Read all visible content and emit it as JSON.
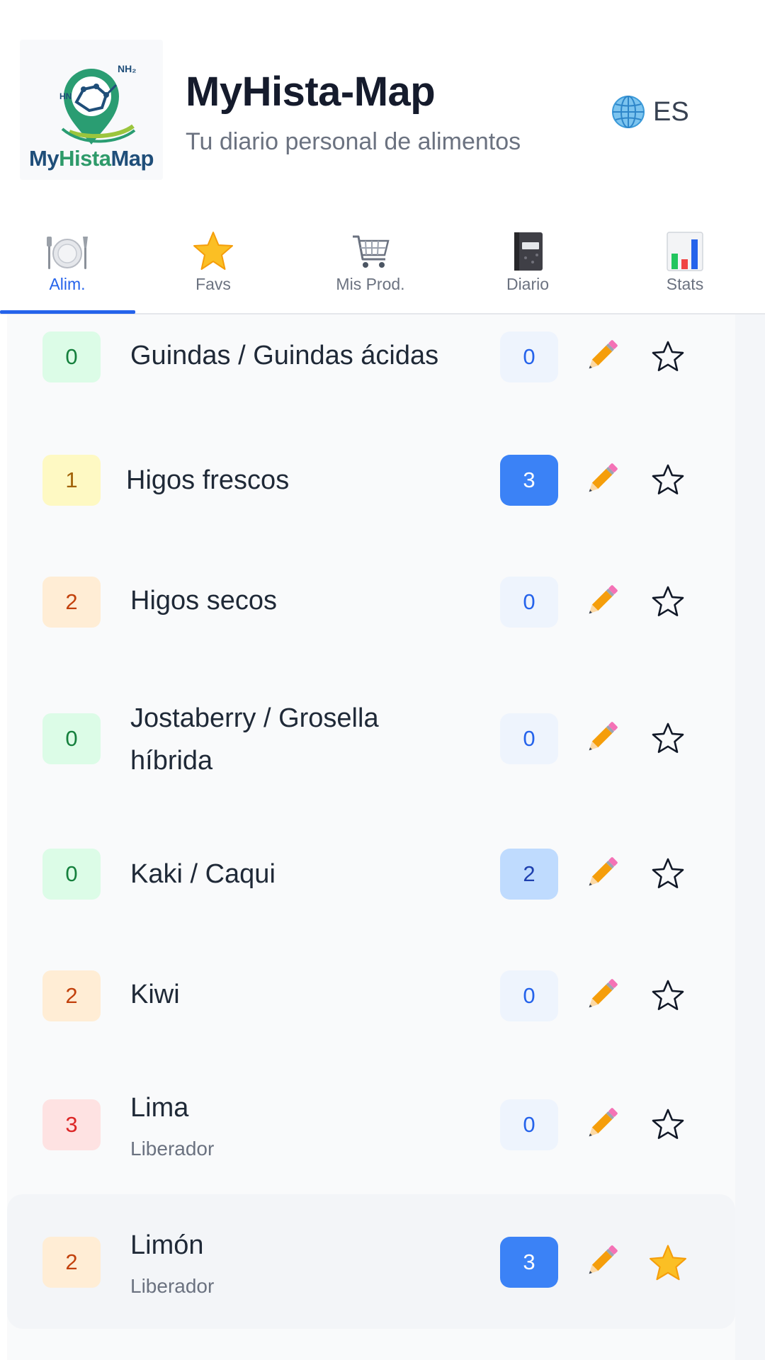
{
  "header": {
    "logo": {
      "word_part1": "My",
      "word_part2": "Hista",
      "word_part3": "Map",
      "molecule_text_top": "NH₂",
      "molecule_text_left": "HN"
    },
    "title": "MyHista-Map",
    "subtitle": "Tu diario personal de alimentos",
    "language": {
      "icon": "globe-icon",
      "label": "ES"
    }
  },
  "tabs": [
    {
      "label": "Alim.",
      "icon": "plate-icon",
      "active": true
    },
    {
      "label": "Favs",
      "icon": "star-icon",
      "active": false
    },
    {
      "label": "Mis Prod.",
      "icon": "cart-icon",
      "active": false
    },
    {
      "label": "Diario",
      "icon": "notebook-icon",
      "active": false
    },
    {
      "label": "Stats",
      "icon": "bar-chart-icon",
      "active": false
    }
  ],
  "foods": [
    {
      "level": "0",
      "name": "Guindas / Guindas ácidas",
      "count": "0",
      "favorite": false
    },
    {
      "level": "1",
      "name": "Higos frescos",
      "count": "3",
      "favorite": false
    },
    {
      "level": "2",
      "name": "Higos secos",
      "count": "0",
      "favorite": false
    },
    {
      "level": "0",
      "name": "Jostaberry / Grosella híbrida",
      "count": "0",
      "favorite": false
    },
    {
      "level": "0",
      "name": "Kaki / Caqui",
      "count": "2",
      "favorite": false
    },
    {
      "level": "2",
      "name": "Kiwi",
      "count": "0",
      "favorite": false
    },
    {
      "level": "3",
      "name": "Lima",
      "sub": "Liberador",
      "count": "0",
      "favorite": false
    },
    {
      "level": "2",
      "name": "Limón",
      "sub": "Liberador",
      "count": "3",
      "favorite": true
    }
  ],
  "colors": {
    "accent": "#2563eb",
    "level0": "#dcfce7",
    "level1": "#fef9c3",
    "level2": "#ffedd5",
    "level3": "#fee2e2",
    "count_dark": "#3b82f6",
    "count_light": "#bfdbfe",
    "count_zero": "#eef4fd"
  }
}
